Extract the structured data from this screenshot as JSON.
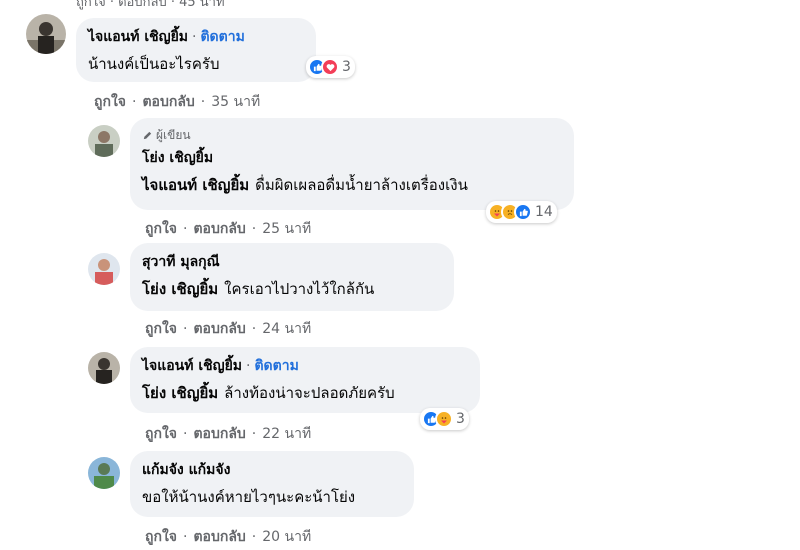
{
  "top_clip": "ถูกใจ · ตอบกลับ · 45 นาที",
  "comments": [
    {
      "author": "ไจแอนท์ เชิญยิ้ม",
      "follow": "ติดตาม",
      "text": "น้านงค์เป็นอะไรครับ",
      "reaction_count": "3",
      "reactions": [
        "like-icon",
        "love-icon"
      ],
      "like": "ถูกใจ",
      "reply": "ตอบกลับ",
      "time": "35 นาที"
    },
    {
      "author_badge": "ผู้เขียน",
      "author": "โย่ง เชิญยิ้ม",
      "mention": "ไจแอนท์ เชิญยิ้ม",
      "text": "ดื่มผิดเผลอดื่มน้ำยาล้างเตรื่องเงิน",
      "reaction_count": "14",
      "reactions": [
        "care-icon",
        "sad-icon",
        "like-icon"
      ],
      "like": "ถูกใจ",
      "reply": "ตอบกลับ",
      "time": "25 นาที"
    },
    {
      "author": "สุวาที มุลกุณี",
      "mention": "โย่ง เชิญยิ้ม",
      "text": "ใครเอาไปวางไว้ใกล้กัน",
      "like": "ถูกใจ",
      "reply": "ตอบกลับ",
      "time": "24 นาที"
    },
    {
      "author": "ไจแอนท์ เชิญยิ้ม",
      "follow": "ติดตาม",
      "mention": "โย่ง เชิญยิ้ม",
      "text": "ล้างท้องน่าจะปลอดภัยครับ",
      "reaction_count": "3",
      "reactions": [
        "like-icon",
        "care-icon"
      ],
      "like": "ถูกใจ",
      "reply": "ตอบกลับ",
      "time": "22 นาที"
    },
    {
      "author": "แก้มจัง แก้มจัง",
      "text": "ขอให้น้านงค์หายไวๆนะคะน้าโย่ง",
      "like": "ถูกใจ",
      "reply": "ตอบกลับ",
      "time": "20 นาที"
    }
  ],
  "separator": "·",
  "colors": {
    "bubble": "#f0f2f5",
    "link": "#216fdb",
    "secondary": "#65676b",
    "like": "#1877f2",
    "love": "#f33e58",
    "haha": "#f7b125"
  }
}
